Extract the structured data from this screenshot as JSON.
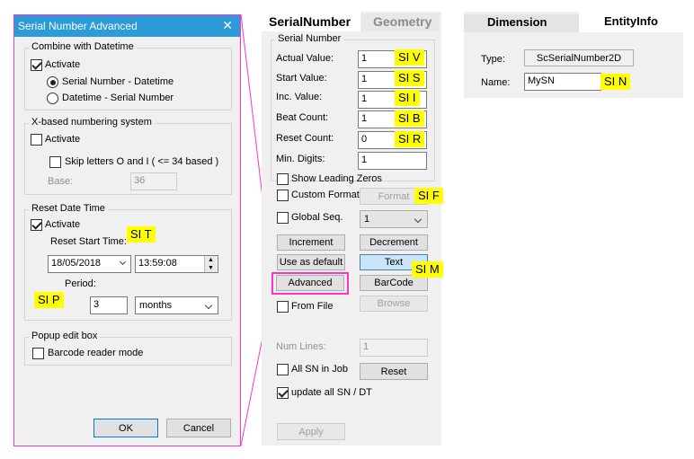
{
  "dialog": {
    "title": "Serial Number Advanced",
    "close_glyph": "✕",
    "combine": {
      "title": "Combine with Datetime",
      "activate": "Activate",
      "opt1": "Serial Number - Datetime",
      "opt2": "Datetime - Serial Number"
    },
    "xbased": {
      "title": "X-based numbering system",
      "activate": "Activate",
      "skip": "Skip letters O and I ( <= 34 based )",
      "base_label": "Base:",
      "base_value": "36"
    },
    "reset": {
      "title": "Reset Date Time",
      "activate": "Activate",
      "start_label": "Reset Start Time:",
      "date": "18/05/2018",
      "time": "13:59:08",
      "period_label": "Period:",
      "period_value": "3",
      "period_unit": "months"
    },
    "popup": {
      "title": "Popup edit box",
      "barcode": "Barcode reader mode"
    },
    "ok": "OK",
    "cancel": "Cancel"
  },
  "panel": {
    "tabs": [
      "SerialNumber",
      "Geometry"
    ],
    "group_title": "Serial Number",
    "actual_label": "Actual Value:",
    "actual_value": "1",
    "start_label": "Start Value:",
    "start_value": "1",
    "inc_label": "Inc. Value:",
    "inc_value": "1",
    "beat_label": "Beat Count:",
    "beat_value": "1",
    "reset_label": "Reset Count:",
    "reset_value": "0",
    "min_label": "Min. Digits:",
    "min_value": "1",
    "show_leading": "Show Leading Zeros",
    "custom_format": "Custom Format",
    "format_btn": "Format",
    "global_seq": "Global Seq.",
    "global_value": "1",
    "increment": "Increment",
    "decrement": "Decrement",
    "use_default": "Use as default",
    "text_btn": "Text",
    "advanced": "Advanced",
    "barcode": "BarCode",
    "from_file": "From File",
    "browse": "Browse",
    "num_lines_label": "Num Lines:",
    "num_lines_value": "1",
    "all_sn": "All SN in Job",
    "reset_btn": "Reset",
    "update_all": "update all SN / DT",
    "apply": "Apply"
  },
  "entity": {
    "tabs": [
      "Dimension",
      "EntityInfo"
    ],
    "type_label": "Type:",
    "type_value": "ScSerialNumber2D",
    "name_label": "Name:",
    "name_value": "MySN"
  },
  "tags": {
    "siv": "SI V",
    "sis": "SI S",
    "sii": "SI I",
    "sib": "SI B",
    "sir": "SI R",
    "sif": "SI F",
    "sim": "SI M",
    "sit": "SI T",
    "sip": "SI P",
    "sin": "SI N"
  },
  "colors": {
    "dialog_border": "#ff33cc",
    "title_bar": "#2b9cd8",
    "highlight": "#ffff00",
    "callout_line": "#ff33cc"
  }
}
